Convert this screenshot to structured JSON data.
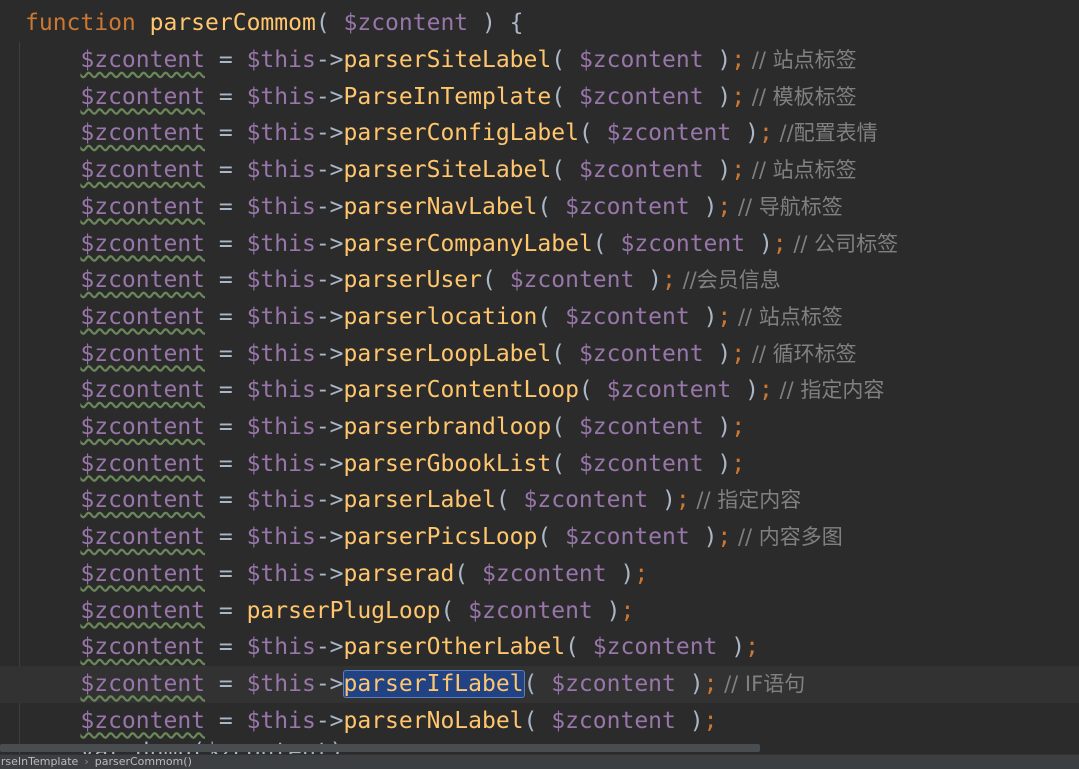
{
  "editor": {
    "function_keyword": "function",
    "function_name": "parserCommom",
    "function_open": "( ",
    "function_param": "$zcontent",
    "function_close": " ) {",
    "lines": [
      {
        "lhs": "$zcontent",
        "assign": " = ",
        "obj": "$this",
        "arrow": "->",
        "method": "parserSiteLabel",
        "open": "( ",
        "arg": "$zcontent",
        "close": " )",
        "semi": ";",
        "comment": " // 站点标签"
      },
      {
        "lhs": "$zcontent",
        "assign": " = ",
        "obj": "$this",
        "arrow": "->",
        "method": "ParseInTemplate",
        "open": "( ",
        "arg": "$zcontent",
        "close": " )",
        "semi": ";",
        "comment": " // 模板标签"
      },
      {
        "lhs": "$zcontent",
        "assign": " = ",
        "obj": "$this",
        "arrow": "->",
        "method": "parserConfigLabel",
        "open": "( ",
        "arg": "$zcontent",
        "close": " )",
        "semi": ";",
        "comment": " //配置表情"
      },
      {
        "lhs": "$zcontent",
        "assign": " = ",
        "obj": "$this",
        "arrow": "->",
        "method": "parserSiteLabel",
        "open": "( ",
        "arg": "$zcontent",
        "close": " )",
        "semi": ";",
        "comment": " // 站点标签"
      },
      {
        "lhs": "$zcontent",
        "assign": " = ",
        "obj": "$this",
        "arrow": "->",
        "method": "parserNavLabel",
        "open": "( ",
        "arg": "$zcontent",
        "close": " )",
        "semi": ";",
        "comment": " // 导航标签"
      },
      {
        "lhs": "$zcontent",
        "assign": " = ",
        "obj": "$this",
        "arrow": "->",
        "method": "parserCompanyLabel",
        "open": "( ",
        "arg": "$zcontent",
        "close": " )",
        "semi": ";",
        "comment": " // 公司标签"
      },
      {
        "lhs": "$zcontent",
        "assign": " = ",
        "obj": "$this",
        "arrow": "->",
        "method": "parserUser",
        "open": "( ",
        "arg": "$zcontent",
        "close": " )",
        "semi": ";",
        "comment": " //会员信息"
      },
      {
        "lhs": "$zcontent",
        "assign": " = ",
        "obj": "$this",
        "arrow": "->",
        "method": "parserlocation",
        "open": "( ",
        "arg": "$zcontent",
        "close": " )",
        "semi": ";",
        "comment": " // 站点标签"
      },
      {
        "lhs": "$zcontent",
        "assign": " = ",
        "obj": "$this",
        "arrow": "->",
        "method": "parserLoopLabel",
        "open": "( ",
        "arg": "$zcontent",
        "close": " )",
        "semi": ";",
        "comment": " // 循环标签"
      },
      {
        "lhs": "$zcontent",
        "assign": " = ",
        "obj": "$this",
        "arrow": "->",
        "method": "parserContentLoop",
        "open": "( ",
        "arg": "$zcontent",
        "close": " )",
        "semi": ";",
        "comment": " // 指定内容"
      },
      {
        "lhs": "$zcontent",
        "assign": " = ",
        "obj": "$this",
        "arrow": "->",
        "method": "parserbrandloop",
        "open": "( ",
        "arg": "$zcontent",
        "close": " )",
        "semi": ";",
        "comment": ""
      },
      {
        "lhs": "$zcontent",
        "assign": " = ",
        "obj": "$this",
        "arrow": "->",
        "method": "parserGbookList",
        "open": "( ",
        "arg": "$zcontent",
        "close": " )",
        "semi": ";",
        "comment": ""
      },
      {
        "lhs": "$zcontent",
        "assign": " = ",
        "obj": "$this",
        "arrow": "->",
        "method": "parserLabel",
        "open": "( ",
        "arg": "$zcontent",
        "close": " )",
        "semi": ";",
        "comment": " // 指定内容"
      },
      {
        "lhs": "$zcontent",
        "assign": " = ",
        "obj": "$this",
        "arrow": "->",
        "method": "parserPicsLoop",
        "open": "( ",
        "arg": "$zcontent",
        "close": " )",
        "semi": ";",
        "comment": " // 内容多图"
      },
      {
        "lhs": "$zcontent",
        "assign": " = ",
        "obj": "$this",
        "arrow": "->",
        "method": "parserad",
        "open": "( ",
        "arg": "$zcontent",
        "close": " )",
        "semi": ";",
        "comment": ""
      },
      {
        "lhs": "$zcontent",
        "assign": " = ",
        "obj": "",
        "arrow": "",
        "method": "parserPlugLoop",
        "open": "( ",
        "arg": "$zcontent",
        "close": " )",
        "semi": ";",
        "comment": ""
      },
      {
        "lhs": "$zcontent",
        "assign": " = ",
        "obj": "$this",
        "arrow": "->",
        "method": "parserOtherLabel",
        "open": "( ",
        "arg": "$zcontent",
        "close": " )",
        "semi": ";",
        "comment": ""
      },
      {
        "lhs": "$zcontent",
        "assign": " = ",
        "obj": "$this",
        "arrow": "->",
        "method": "parserIfLabel",
        "open": "( ",
        "arg": "$zcontent",
        "close": " )",
        "semi": ";",
        "comment": " // IF语句",
        "current": true,
        "selected": true
      },
      {
        "lhs": "$zcontent",
        "assign": " = ",
        "obj": "$this",
        "arrow": "->",
        "method": "parserNoLabel",
        "open": "( ",
        "arg": "$zcontent",
        "close": " )",
        "semi": ";",
        "comment": ""
      }
    ],
    "partial_line": "    var_dump($zcontent);"
  },
  "breadcrumb": {
    "items": [
      "ParseInTemplate",
      "parserCommom()"
    ],
    "separator": "›"
  },
  "colors": {
    "background": "#2b2b2b",
    "keyword": "#cc7832",
    "function": "#ffc66d",
    "variable": "#9876aa",
    "comment": "#808080",
    "text": "#a9b7c6",
    "selection": "#214283"
  }
}
